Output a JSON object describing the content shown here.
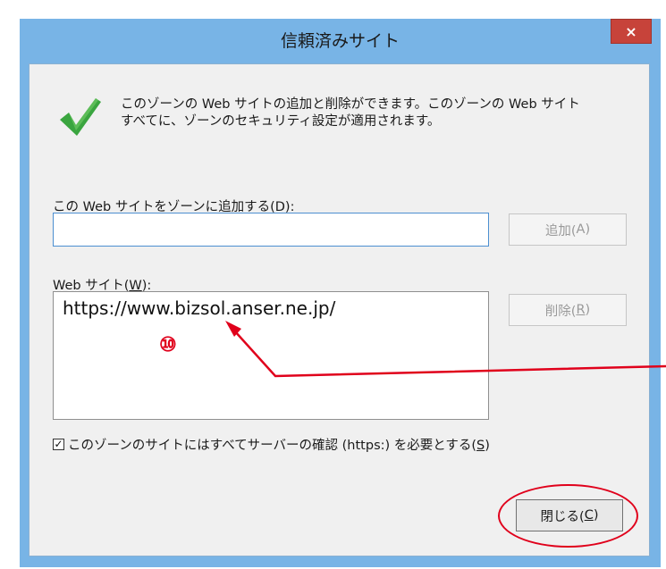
{
  "dialog": {
    "title": "信頼済みサイト",
    "close_glyph": "×",
    "description_line1": "このゾーンの Web サイトの追加と削除ができます。このゾーンの Web サイト",
    "description_line2": "すべてに、ゾーンのセキュリティ設定が適用されます。",
    "icon": "green-checkmark-icon"
  },
  "add_section": {
    "label": "この Web サイトをゾーンに追加する(D):",
    "input_value": "",
    "add_button": {
      "text": "追加(",
      "key": "A",
      "suffix": ")"
    }
  },
  "sites_section": {
    "label_prefix": "Web サイト(",
    "label_key": "W",
    "label_suffix": "):",
    "items": [
      "https://www.bizsol.anser.ne.jp/"
    ],
    "remove_button": {
      "text": "削除(",
      "key": "R",
      "suffix": ")"
    }
  },
  "https_option": {
    "checked": true,
    "check_glyph": "✓",
    "label_prefix": "このゾーンのサイトにはすべてサーバーの確認 (https:) を必要とする(",
    "label_key": "S",
    "label_suffix": ")"
  },
  "close_button": {
    "text": "閉じる(",
    "key": "C",
    "suffix": ")"
  },
  "annotations": {
    "marker_label": "⑩",
    "highlight_color": "#e0001b"
  }
}
